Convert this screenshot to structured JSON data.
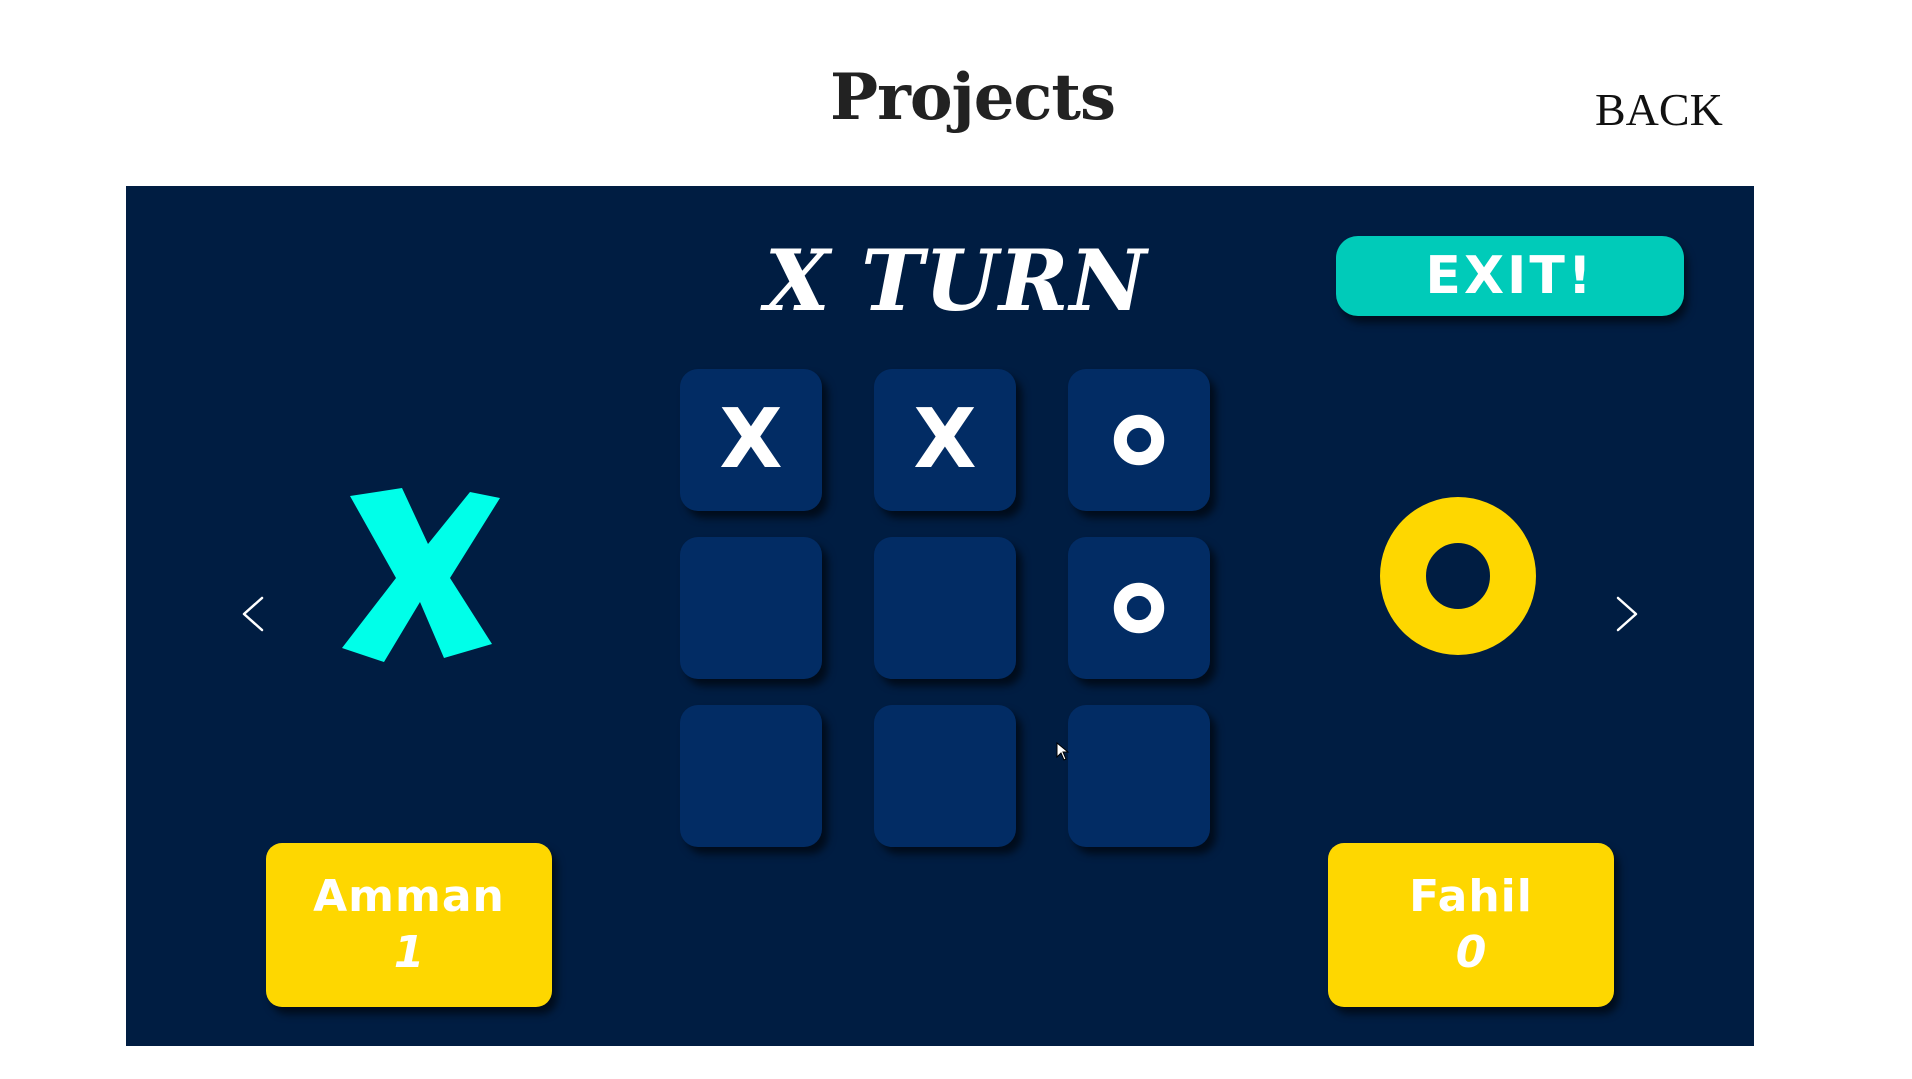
{
  "header": {
    "title": "Projects",
    "back_label": "BACK"
  },
  "game": {
    "turn_text": "X TURN",
    "exit_label": "EXIT!",
    "board": [
      [
        "X",
        "X",
        "O"
      ],
      [
        "",
        "",
        "O"
      ],
      [
        "",
        "",
        ""
      ]
    ],
    "left_player": {
      "mark_icon": "x-mark",
      "mark_color": "#00ffe9",
      "name": "Amman",
      "score": "1"
    },
    "right_player": {
      "mark_icon": "o-mark",
      "mark_color": "#fed700",
      "name": "Fahil",
      "score": "0"
    },
    "icons": {
      "prev": "chevron-left-icon",
      "next": "chevron-right-icon"
    },
    "colors": {
      "background": "#001d42",
      "cell": "#022c64",
      "exit_button": "#00cbb9",
      "score_card": "#fed700"
    }
  }
}
